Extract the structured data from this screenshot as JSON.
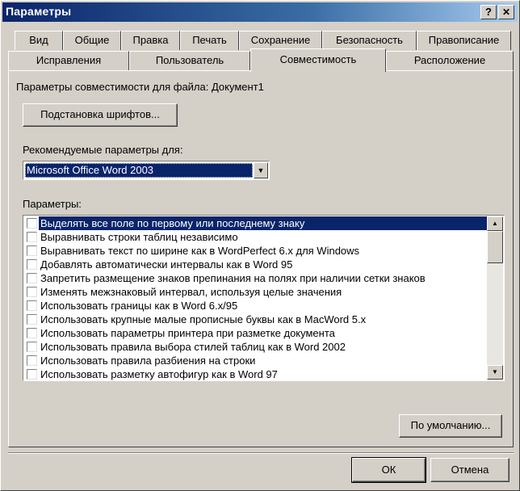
{
  "window": {
    "title": "Параметры",
    "help_label": "?",
    "close_label": "✕"
  },
  "tabs": {
    "row1": [
      "Вид",
      "Общие",
      "Правка",
      "Печать",
      "Сохранение",
      "Безопасность",
      "Правописание"
    ],
    "row2": [
      "Исправления",
      "Пользователь",
      "Совместимость",
      "Расположение"
    ],
    "active": "Совместимость"
  },
  "compat": {
    "file_label": "Параметры совместимости для файла: Документ1",
    "font_sub_button": "Подстановка шрифтов...",
    "recommended_label": "Рекомендуемые параметры для:",
    "recommended_value": "Microsoft Office Word 2003",
    "options_label": "Параметры:",
    "options": [
      {
        "text": "Выделять все поле по первому или последнему знаку",
        "checked": false,
        "selected": true
      },
      {
        "text": "Выравнивать строки таблиц независимо",
        "checked": false,
        "selected": false
      },
      {
        "text": "Выравнивать текст по ширине как в WordPerfect 6.x для Windows",
        "checked": false,
        "selected": false
      },
      {
        "text": "Добавлять автоматически интервалы как в Word 95",
        "checked": false,
        "selected": false
      },
      {
        "text": "Запретить размещение знаков препинания на полях при наличии сетки знаков",
        "checked": false,
        "selected": false
      },
      {
        "text": "Изменять межзнаковый интервал, используя целые значения",
        "checked": false,
        "selected": false
      },
      {
        "text": "Использовать границы как в Word 6.x/95",
        "checked": false,
        "selected": false
      },
      {
        "text": "Использовать крупные малые прописные буквы как в MacWord 5.x",
        "checked": false,
        "selected": false
      },
      {
        "text": "Использовать параметры принтера при разметке документа",
        "checked": false,
        "selected": false
      },
      {
        "text": "Использовать правила выбора стилей таблиц как в Word 2002",
        "checked": false,
        "selected": false
      },
      {
        "text": "Использовать правила разбиения на строки",
        "checked": false,
        "selected": false
      },
      {
        "text": "Использовать разметку автофигур как в Word 97",
        "checked": false,
        "selected": false
      }
    ],
    "default_button": "По умолчанию..."
  },
  "footer": {
    "ok": "ОК",
    "cancel": "Отмена"
  },
  "icons": {
    "combo_arrow": "▼",
    "scroll_up": "▲",
    "scroll_down": "▼"
  }
}
